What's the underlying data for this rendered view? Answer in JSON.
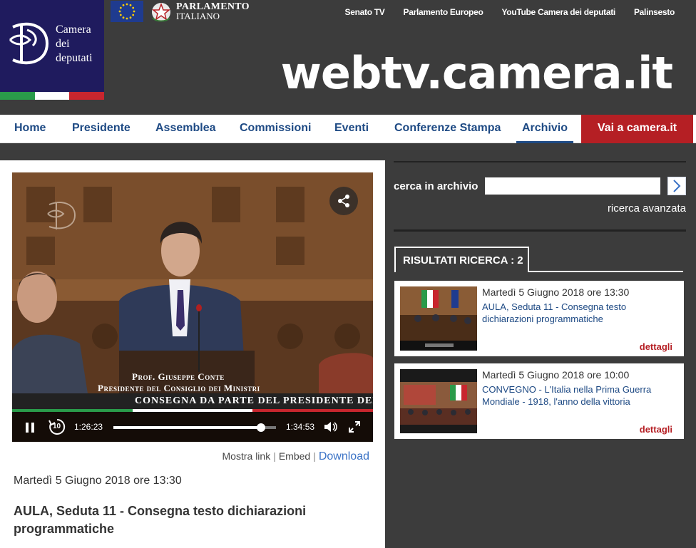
{
  "header": {
    "logo_text": [
      "Camera",
      "dei",
      "deputati"
    ],
    "parliament_line1": "PARLAMENTO",
    "parliament_line2": "ITALIANO",
    "top_links": [
      "Senato TV",
      "Parlamento Europeo",
      "YouTube Camera dei deputati",
      "Palinsesto"
    ],
    "brand": "webtv.camera.it"
  },
  "nav": {
    "items": [
      "Home",
      "Presidente",
      "Assemblea",
      "Commissioni",
      "Eventi",
      "Conferenze Stampa",
      "Archivio"
    ],
    "active": "Archivio",
    "cta": "Vai a camera.it"
  },
  "player": {
    "caption_name": "Prof. Giuseppe Conte",
    "caption_role": "Presidente del Consiglio dei Ministri",
    "banner": "CONSEGNA DA PARTE DEL PRESIDENTE DEL C",
    "current_time": "1:26:23",
    "duration": "1:34:53",
    "progress": 0.91,
    "replay_seconds": "10"
  },
  "video_links": {
    "show_link": "Mostra link",
    "embed": "Embed",
    "download": "Download"
  },
  "video_info": {
    "date": "Martedì 5 Giugno 2018 ore 13:30",
    "title": "AULA, Seduta 11 - Consegna testo dichiarazioni programmatiche"
  },
  "search": {
    "label": "cerca in archivio",
    "value": "",
    "advanced": "ricerca avanzata"
  },
  "results": {
    "tab_label": "RISULTATI RICERCA : 2",
    "items": [
      {
        "date": "Martedì 5 Giugno 2018 ore 13:30",
        "title": "AULA, Seduta 11 - Consegna testo dichiarazioni programmatiche",
        "details": "dettagli"
      },
      {
        "date": "Martedì 5 Giugno 2018 ore 10:00",
        "title": "CONVEGNO - L'Italia nella Prima Guerra Mondiale - 1918, l'anno della vittoria",
        "details": "dettagli"
      }
    ]
  },
  "colors": {
    "brand_blue": "#1e4a84",
    "cta_red": "#b51f24",
    "background": "#3c3c3c",
    "logo_navy": "#1f1b5e"
  }
}
